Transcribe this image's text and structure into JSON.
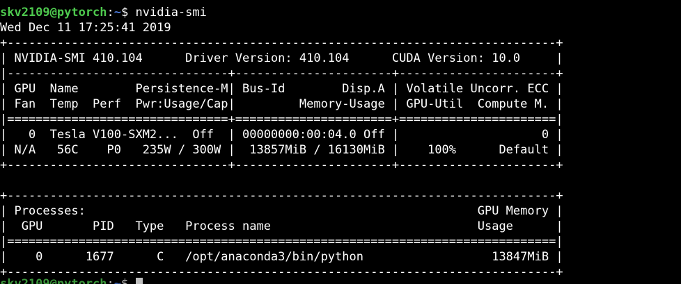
{
  "prompt": {
    "user_host": "skv2109@pytorch",
    "sep": ":",
    "dir": "~",
    "symbol": "$",
    "command": " nvidia-smi"
  },
  "output_lines": [
    "Wed Dec 11 17:25:41 2019",
    "+-----------------------------------------------------------------------------+",
    "| NVIDIA-SMI 410.104      Driver Version: 410.104      CUDA Version: 10.0     |",
    "|-------------------------------+----------------------+----------------------+",
    "| GPU  Name        Persistence-M| Bus-Id        Disp.A | Volatile Uncorr. ECC |",
    "| Fan  Temp  Perf  Pwr:Usage/Cap|         Memory-Usage | GPU-Util  Compute M. |",
    "|===============================+======================+======================|",
    "|   0  Tesla V100-SXM2...  Off  | 00000000:00:04.0 Off |                    0 |",
    "| N/A   56C    P0   235W / 300W |  13857MiB / 16130MiB |    100%      Default |",
    "+-------------------------------+----------------------+----------------------+",
    "",
    "+-----------------------------------------------------------------------------+",
    "| Processes:                                                       GPU Memory |",
    "|  GPU       PID   Type   Process name                             Usage      |",
    "|=============================================================================|",
    "|    0      1677      C   /opt/anaconda3/bin/python                  13847MiB |",
    "+-----------------------------------------------------------------------------+"
  ],
  "final_prompt": {
    "user_host": "skv2109@pytorch",
    "sep": ":",
    "dir": "~",
    "symbol": "$ "
  },
  "colors": {
    "background": "#000000",
    "text": "#ffffff",
    "user_host": "#4ec94e",
    "path": "#4f7ddf"
  }
}
